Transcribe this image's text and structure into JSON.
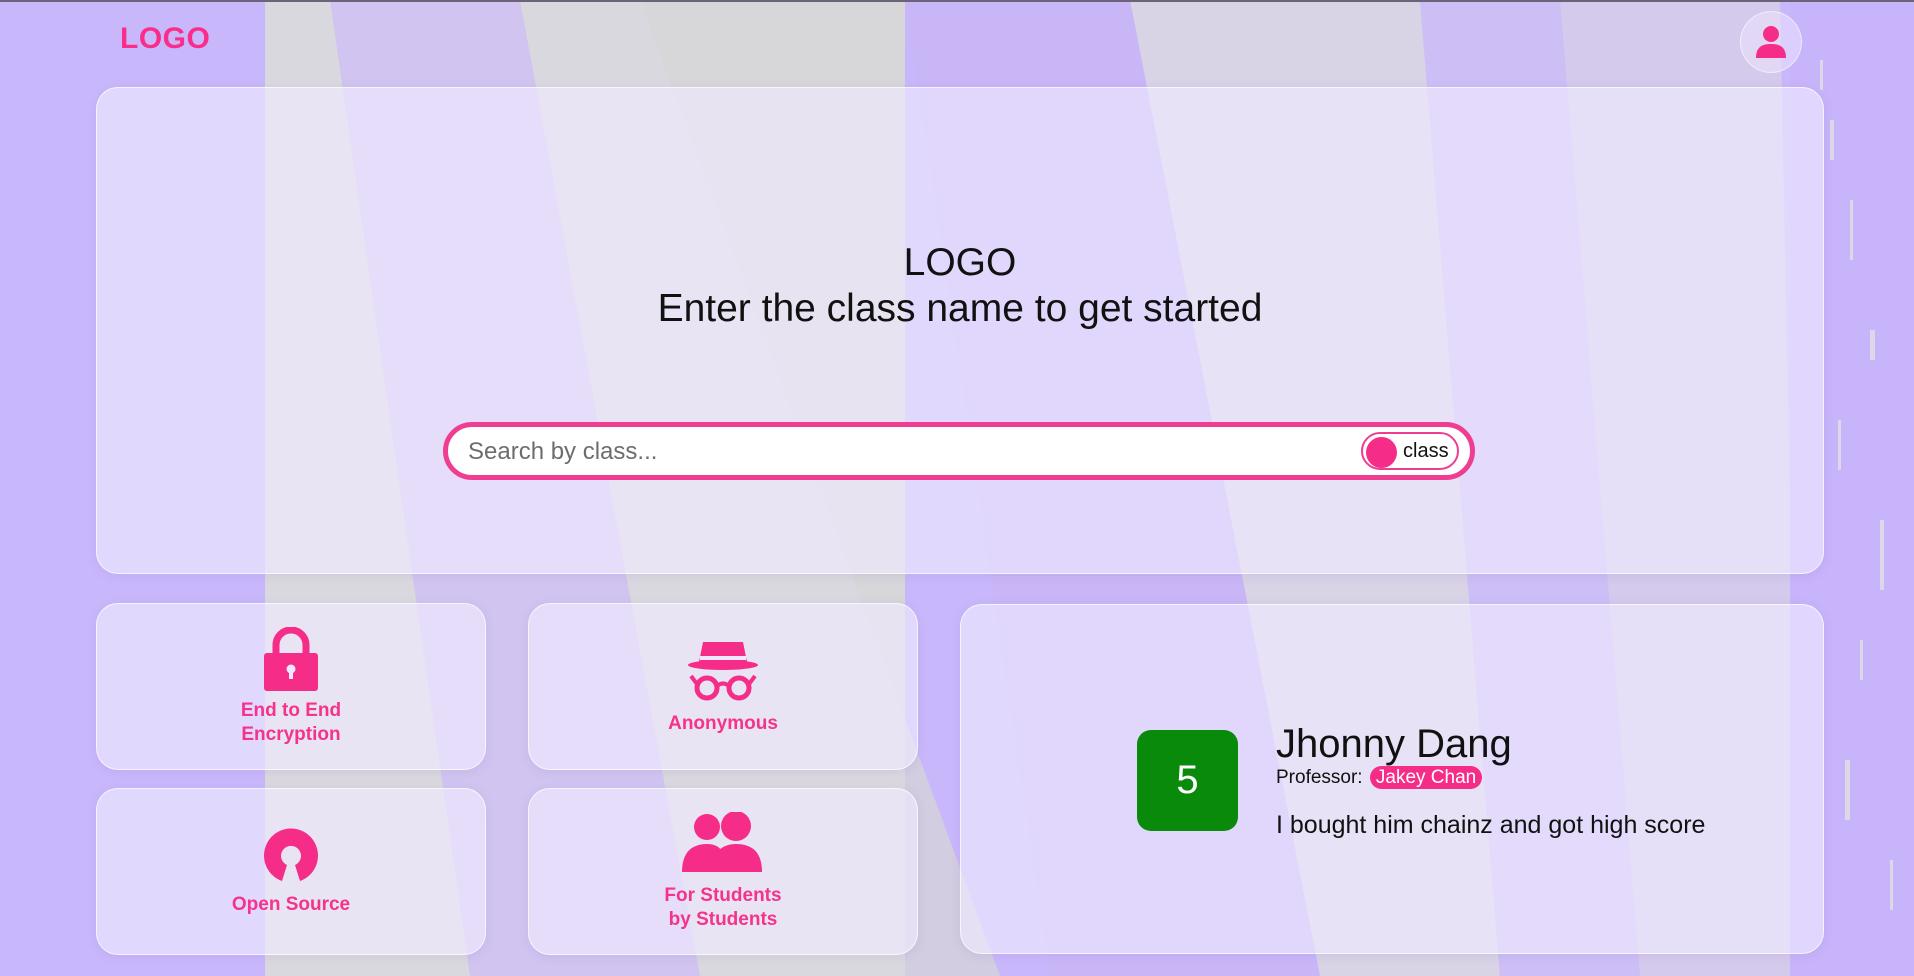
{
  "header": {
    "logo_text": "LOGO",
    "account_icon": "user-icon"
  },
  "hero": {
    "logo_text": "LOGO",
    "tagline": "Enter the class name to get started",
    "search": {
      "placeholder": "Search by class...",
      "value": "",
      "toggle_label": "class"
    }
  },
  "features": [
    {
      "label_line1": "End to End",
      "label_line2": "Encryption",
      "icon": "lock-icon"
    },
    {
      "label_line1": "Anonymous",
      "label_line2": "",
      "icon": "incognito-icon"
    },
    {
      "label_line1": "Open Source",
      "label_line2": "",
      "icon": "open-source-icon"
    },
    {
      "label_line1": "For Students",
      "label_line2": "by Students",
      "icon": "users-icon"
    }
  ],
  "review": {
    "score": "5",
    "student_name": "Jhonny Dang",
    "professor_label": "Professor:",
    "professor_name": "Jakey Chan",
    "text": "I bought him chainz and got high score",
    "score_color": "#0a8a0a"
  },
  "colors": {
    "accent": "#f52d88",
    "background": "#c9b7fb",
    "card": "#efe8ff"
  }
}
